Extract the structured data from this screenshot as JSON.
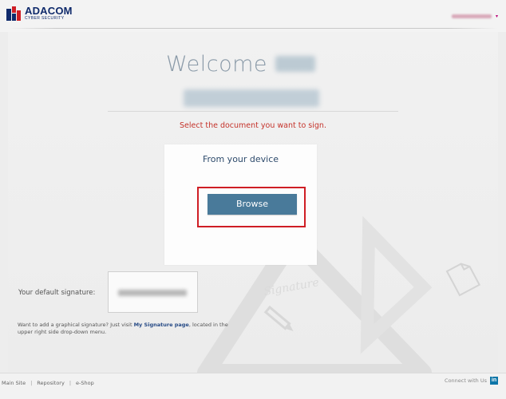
{
  "brand": {
    "name": "ADACOM",
    "tagline": "CYBER SECURITY",
    "colors": {
      "navy": "#0f2a6b",
      "red": "#cf1e25"
    }
  },
  "header": {
    "user_name": "[blurred]",
    "caret": "▾"
  },
  "main": {
    "welcome_word": "Welcome",
    "user_first_name": "[blurred]",
    "user_full_name": "[blurred]",
    "instruction": "Select the document you want to sign.",
    "device_panel": {
      "title": "From your device",
      "browse_label": "Browse"
    },
    "signature": {
      "label": "Your default signature:",
      "value": "[blurred]"
    },
    "info": {
      "text_before": "Want to add a graphical signature? Just visit ",
      "link_text": "My Signature page",
      "text_after": ", located in the upper right side drop-down menu."
    },
    "watermark_text": "Signature"
  },
  "footer": {
    "links": [
      "Main Site",
      "Repository",
      "e-Shop"
    ],
    "separator": "|",
    "connect_label": "Connect with Us",
    "linkedin_glyph": "in"
  },
  "colors": {
    "accent_button": "#497a9a",
    "instruction_text": "#c5332b",
    "linkedin": "#0e76a8"
  },
  "icons": [
    "adacom-logo-icon",
    "chevron-down-icon",
    "pencil-icon",
    "document-icon",
    "linkedin-icon"
  ]
}
